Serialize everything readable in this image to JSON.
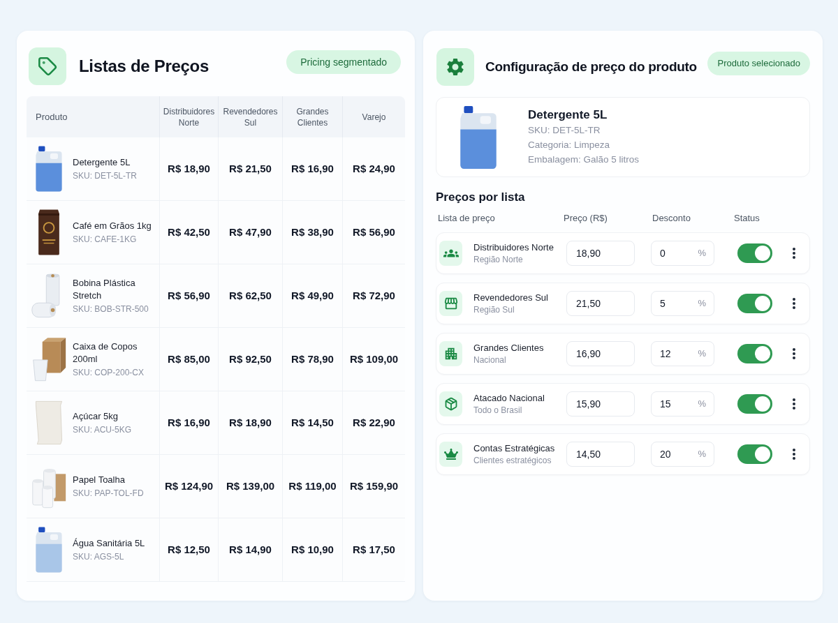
{
  "price_lists_panel": {
    "title": "Listas de Preços",
    "badge": "Pricing segmentado",
    "table": {
      "columns": [
        "Produto",
        "Distribuidores Norte",
        "Revendedores Sul",
        "Grandes Clientes",
        "Varejo"
      ],
      "rows": [
        {
          "kind": "jug",
          "name": "Detergente 5L",
          "sku": "SKU: DET-5L-TR",
          "prices": [
            "R$ 18,90",
            "R$ 21,50",
            "R$ 16,90",
            "R$ 24,90"
          ]
        },
        {
          "kind": "coffee",
          "name": "Café em Grãos 1kg",
          "sku": "SKU: CAFE-1KG",
          "prices": [
            "R$ 42,50",
            "R$ 47,90",
            "R$ 38,90",
            "R$ 56,90"
          ]
        },
        {
          "kind": "roll",
          "name": "Bobina Plástica Stretch",
          "sku": "SKU: BOB-STR-500",
          "prices": [
            "R$ 56,90",
            "R$ 62,50",
            "R$ 49,90",
            "R$ 72,90"
          ]
        },
        {
          "kind": "box",
          "name": "Caixa de Copos 200ml",
          "sku": "SKU: COP-200-CX",
          "prices": [
            "R$ 85,00",
            "R$ 92,50",
            "R$ 78,90",
            "R$ 109,00"
          ]
        },
        {
          "kind": "sack",
          "name": "Açúcar 5kg",
          "sku": "SKU: ACU-5KG",
          "prices": [
            "R$ 16,90",
            "R$ 18,90",
            "R$ 14,50",
            "R$ 22,90"
          ]
        },
        {
          "kind": "towels",
          "name": "Papel Toalha",
          "sku": "SKU: PAP-TOL-FD",
          "prices": [
            "R$ 124,90",
            "R$ 139,00",
            "R$ 119,00",
            "R$ 159,90"
          ]
        },
        {
          "kind": "bleach",
          "name": "Água Sanitária 5L",
          "sku": "SKU: AGS-5L",
          "prices": [
            "R$ 12,50",
            "R$ 14,90",
            "R$ 10,90",
            "R$ 17,50"
          ]
        }
      ]
    }
  },
  "product_pricing_panel": {
    "title": "Configuração de preço do produto",
    "badge": "Produto selecionado",
    "product": {
      "kind": "jug",
      "name": "Detergente 5L",
      "details": [
        "SKU: DET-5L-TR",
        "Categoria: Limpeza",
        "Embalagem: Galão 5 litros"
      ]
    },
    "section_title": "Preços por lista",
    "columns": [
      "Lista de preço",
      "Preço (R$)",
      "Desconto",
      "Status"
    ],
    "price_lists": [
      {
        "kind": "group",
        "name": "Distribuidores Norte",
        "region": "Região Norte",
        "price": "18,90",
        "discount": "0",
        "unit": "%",
        "on": true
      },
      {
        "kind": "store",
        "name": "Revendedores Sul",
        "region": "Região Sul",
        "price": "21,50",
        "discount": "5",
        "unit": "%",
        "on": true
      },
      {
        "kind": "building",
        "name": "Grandes Clientes",
        "region": "Nacional",
        "price": "16,90",
        "discount": "12",
        "unit": "%",
        "on": true
      },
      {
        "kind": "package",
        "name": "Atacado Nacional",
        "region": "Todo o Brasil",
        "price": "15,90",
        "discount": "15",
        "unit": "%",
        "on": true
      },
      {
        "kind": "crown",
        "name": "Contas Estratégicas",
        "region": "Clientes estratégicos",
        "price": "14,50",
        "discount": "20",
        "unit": "%",
        "on": true
      }
    ]
  }
}
